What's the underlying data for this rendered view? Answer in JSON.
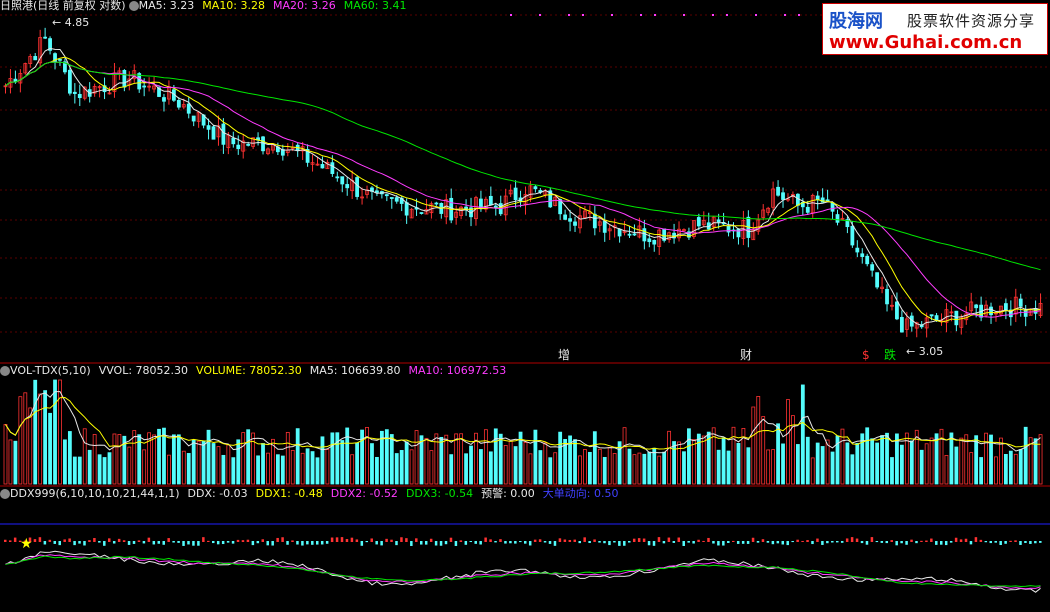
{
  "main_panel": {
    "title": "日照港(日线 前复权 对数)",
    "indicators": [
      {
        "label": "MA5: 3.23",
        "color": "#e8e8e8"
      },
      {
        "label": "MA10: 3.28",
        "color": "#ffff00"
      },
      {
        "label": "MA20: 3.26",
        "color": "#ff3cff"
      },
      {
        "label": "MA60: 3.41",
        "color": "#00e600"
      }
    ],
    "high_label": "4.85",
    "low_label": "3.05",
    "event_markers": [
      {
        "text": "增",
        "color": "#e8e8e8"
      },
      {
        "text": "财",
        "color": "#e8e8e8"
      },
      {
        "text": "$",
        "color": "#ff3333"
      },
      {
        "text": "跌",
        "color": "#00e600"
      }
    ]
  },
  "vol_panel": {
    "title": "VOL-TDX(5,10)",
    "indicators": [
      {
        "label": "VVOL: 78052.30",
        "color": "#e8e8e8"
      },
      {
        "label": "VOLUME: 78052.30",
        "color": "#ffff00"
      },
      {
        "label": "MA5: 106639.80",
        "color": "#e8e8e8"
      },
      {
        "label": "MA10: 106972.53",
        "color": "#ff3cff"
      }
    ]
  },
  "ddx_panel": {
    "title": "DDX999(6,10,10,10,21,44,1,1)",
    "indicators": [
      {
        "label": "DDX: -0.03",
        "color": "#e8e8e8"
      },
      {
        "label": "DDX1: -0.48",
        "color": "#ffff00"
      },
      {
        "label": "DDX2: -0.52",
        "color": "#ff3cff"
      },
      {
        "label": "DDX3: -0.54",
        "color": "#00e600"
      },
      {
        "label": "预警: 0.00",
        "color": "#e8e8e8"
      },
      {
        "label": "大单动向: 0.50",
        "color": "#4040ff"
      }
    ]
  },
  "logo": {
    "name": "股海网",
    "slogan": "股票软件资源分享",
    "url": "www.Guhai.com.cn"
  },
  "chart_data": {
    "type": "candlestick",
    "price_range": [
      3.05,
      4.85
    ],
    "ma_values": {
      "MA5": 3.23,
      "MA10": 3.28,
      "MA20": 3.26,
      "MA60": 3.41
    },
    "volume": {
      "VVOL": 78052.3,
      "VOLUME": 78052.3,
      "MA5": 106639.8,
      "MA10": 106972.53
    },
    "ddx": {
      "DDX": -0.03,
      "DDX1": -0.48,
      "DDX2": -0.52,
      "DDX3": -0.54,
      "预警": 0.0,
      "大单动向": 0.5
    }
  }
}
